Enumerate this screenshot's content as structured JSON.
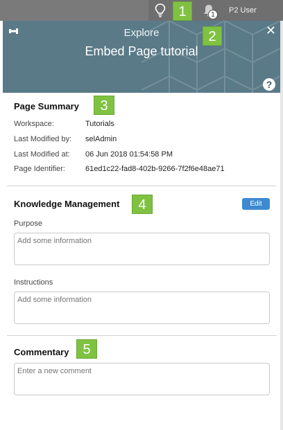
{
  "topbar": {
    "user_name": "P2 User",
    "notification_count": "1"
  },
  "callouts": [
    "1",
    "2",
    "3",
    "4",
    "5"
  ],
  "header": {
    "label": "Explore",
    "title": "Embed Page tutorial",
    "close_glyph": "✕",
    "help_glyph": "?"
  },
  "page_summary": {
    "title": "Page Summary",
    "rows": [
      {
        "label": "Workspace:",
        "value": "Tutorials"
      },
      {
        "label": "Last Modified by:",
        "value": "selAdmin"
      },
      {
        "label": "Last Modified at:",
        "value": "06 Jun 2018 01:54:58 PM"
      },
      {
        "label": "Page Identifier:",
        "value": "61ed1c22-fad8-402b-9266-7f2f6e48ae71"
      }
    ]
  },
  "knowledge": {
    "title": "Knowledge Management",
    "edit_label": "Edit",
    "purpose_label": "Purpose",
    "purpose_placeholder": "Add some information",
    "instructions_label": "Instructions",
    "instructions_placeholder": "Add some information"
  },
  "commentary": {
    "title": "Commentary",
    "comment_placeholder": "Enter a new comment"
  },
  "colors": {
    "header_bg": "#5a7a88",
    "callout_green": "#7fc241",
    "edit_button": "#3d8ad0",
    "topbar_bg": "#6f6f6f"
  },
  "icons": [
    "lightbulb-icon",
    "bell-icon",
    "pin-icon",
    "close-icon",
    "help-icon"
  ]
}
